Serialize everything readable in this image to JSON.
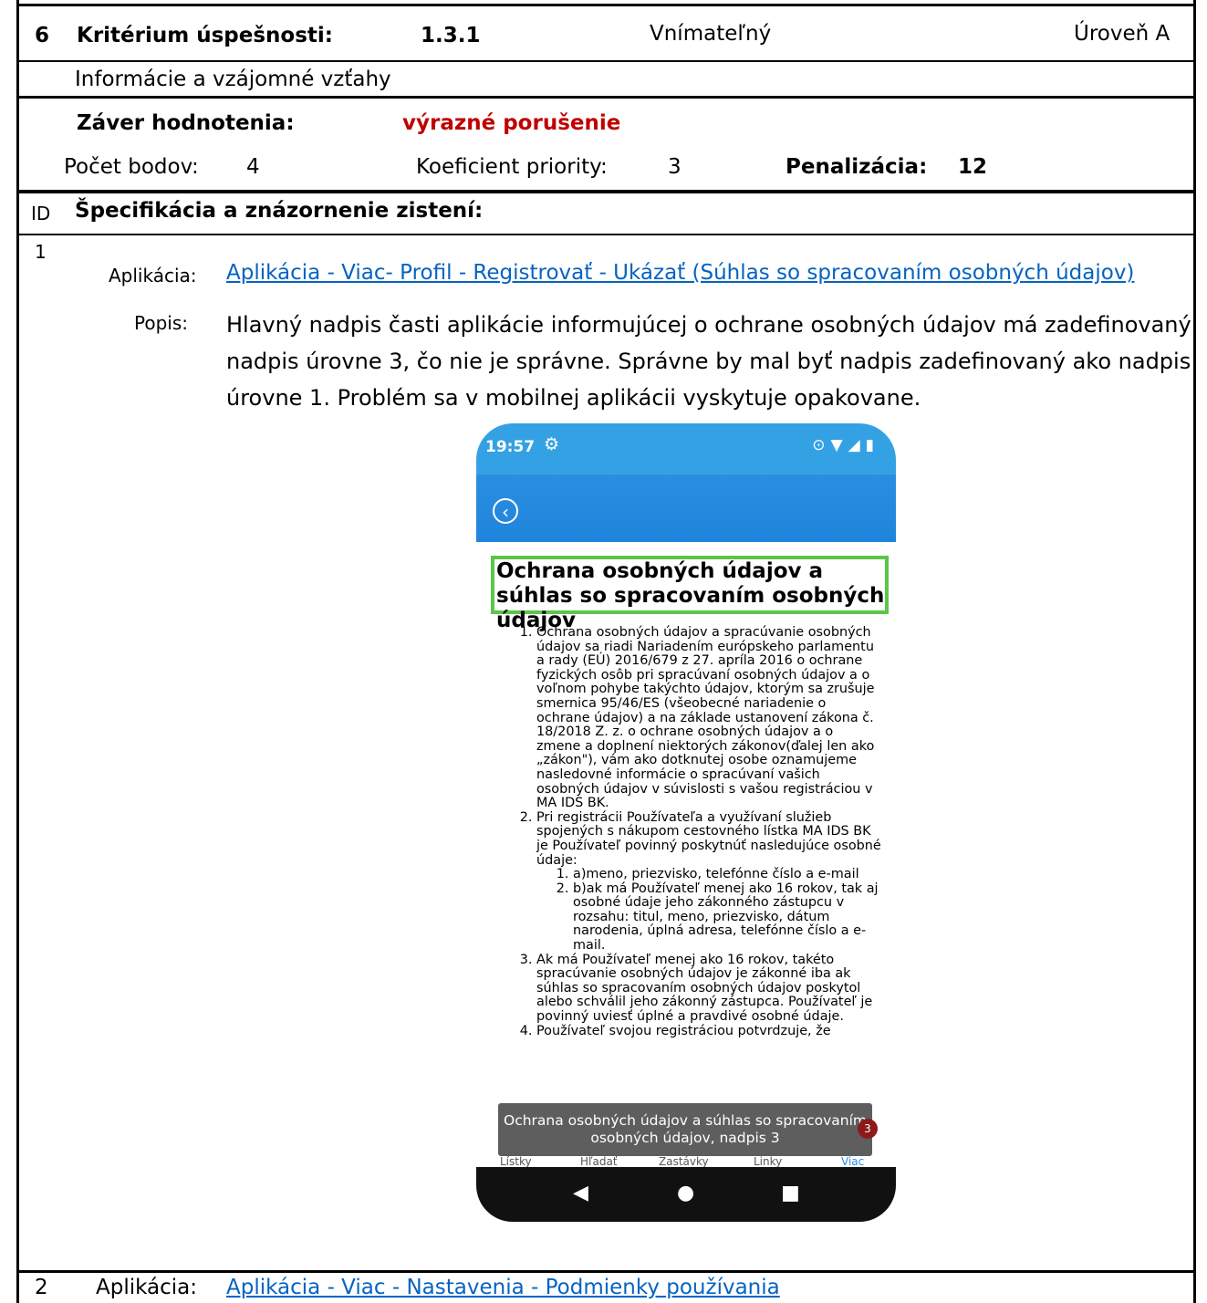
{
  "header": {
    "number": "6",
    "criterion_label": "Kritérium úspešnosti:",
    "criterion_code": "1.3.1",
    "principle": "Vnímateľný",
    "level": "Úroveň A"
  },
  "criterion_title": "Informácie a vzájomné vzťahy",
  "conclusion": {
    "label": "Záver hodnotenia:",
    "value": "výrazné porušenie",
    "value_color": "#c00000"
  },
  "scores": {
    "points_label": "Počet bodov:",
    "points_value": "4",
    "priority_label": "Koeficient priority:",
    "priority_value": "3",
    "penalty_label": "Penalizácia:",
    "penalty_value": "12"
  },
  "findings_header": {
    "id_label": "ID",
    "title": "Špecifikácia a znázornenie zistení:"
  },
  "findings": [
    {
      "id": "1",
      "app_label": "Aplikácia:",
      "app_path": "Aplikácia - Viac- Profil - Registrovať - Ukázať (Súhlas so spracovaním osobných údajov)",
      "desc_label": "Popis:",
      "description": "Hlavný nadpis časti aplikácie informujúcej o ochrane osobných údajov má zadefinovaný nadpis úrovne 3, čo nie je správne. Správne by mal byť nadpis zadefinovaný ako nadpis úrovne 1. Problém sa v mobilnej aplikácii vyskytuje opakovane."
    },
    {
      "id": "2",
      "app_label": "Aplikácia:",
      "app_path": "Aplikácia - Viac - Nastavenia - Podmienky používania"
    }
  ],
  "phone": {
    "time": "19:57",
    "heading": "Ochrana osobných údajov a súhlas so spracovaním osobných údajov",
    "items": [
      "Ochrana osobných údajov a spracúvanie osobných údajov sa riadi Nariadením európskeho parlamentu a rady (EÚ) 2016/679 z 27. apríla 2016 o ochrane fyzických osôb pri spracúvaní osobných údajov a o voľnom pohybe takýchto údajov, ktorým sa zrušuje smernica 95/46/ES (všeobecné nariadenie o ochrane údajov) a na základe ustanovení zákona č. 18/2018 Z. z. o ochrane osobných údajov a o zmene a doplnení niektorých zákonov(ďalej len ako „zákon\"), vám ako dotknutej osobe oznamujeme nasledovné informácie o spracúvaní vašich osobných údajov v súvislosti s vašou registráciou v MA IDS BK.",
      "Pri registrácii Používateľa a využívaní služieb spojených s nákupom cestovného lístka MA IDS BK je Používateľ povinný poskytnúť nasledujúce osobné údaje:",
      "Ak má Používateľ menej ako 16 rokov, takéto spracúvanie osobných údajov je zákonné iba ak súhlas so spracovaním osobných údajov poskytol alebo schválil jeho zákonný zástupca. Používateľ je povinný uviesť úplné a pravdivé osobné údaje.",
      "Používateľ svojou registráciou potvrdzuje, že"
    ],
    "subitems": [
      "a)meno, priezvisko, telefónne číslo a e-mail",
      "b)ak má Používateľ menej ako 16 rokov, tak aj osobné údaje jeho zákonného zástupcu v rozsahu: titul, meno, priezvisko, dátum narodenia, úplná adresa, telefónne číslo a e-mail."
    ],
    "toast": "Ochrana osobných údajov a súhlas so spracovaním osobných údajov, nadpis 3",
    "badge": "3",
    "tabs": [
      "Lístky",
      "Hľadať",
      "Zastávky",
      "Linky",
      "Viac"
    ],
    "heading_border_color": "#5cc54a",
    "bar_color": "#34a1e4"
  }
}
